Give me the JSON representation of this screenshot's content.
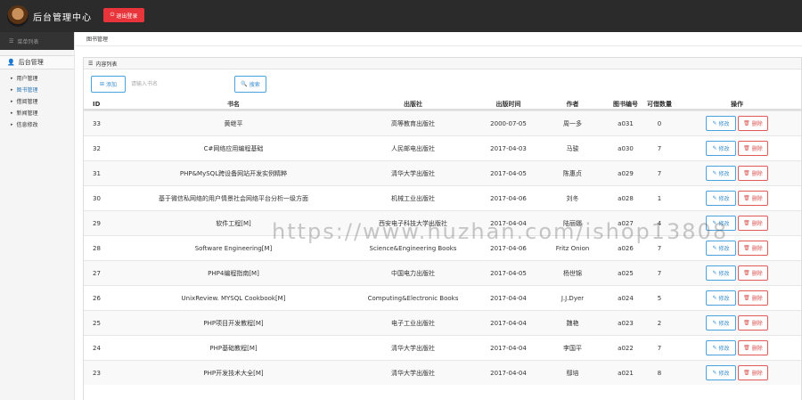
{
  "header": {
    "title": "后台管理中心",
    "logout_label": "退出登录",
    "accent": "#e7353b"
  },
  "sidebar": {
    "top_label": "菜单列表",
    "section_title": "后台管理",
    "items": [
      {
        "label": "用户管理"
      },
      {
        "label": "图书管理"
      },
      {
        "label": "借阅管理"
      },
      {
        "label": "新闻管理"
      },
      {
        "label": "信息修改"
      }
    ]
  },
  "main": {
    "breadcrumb": "图书管理",
    "panel_title": "内容列表",
    "add_label": "添加",
    "search_placeholder": "请输入书名",
    "search_label": "搜索"
  },
  "table": {
    "headers": [
      "ID",
      "书名",
      "出版社",
      "出版时间",
      "作者",
      "图书编号",
      "可借数量",
      "操作"
    ],
    "edit_label": "修改",
    "delete_label": "删除",
    "rows": [
      [
        "33",
        "黄继平",
        "高等教育出版社",
        "2000-07-05",
        "周一多",
        "a031",
        "0"
      ],
      [
        "32",
        "C#网络应用编程基础",
        "人民邮电出版社",
        "2017-04-03",
        "马骏",
        "a030",
        "7"
      ],
      [
        "31",
        "PHP&MySQL跨设备网站开发实例精粹",
        "清华大学出版社",
        "2017-04-05",
        "陈惠贞",
        "a029",
        "7"
      ],
      [
        "30",
        "基于微信私网络的用户情景社会网络平台分析一级方面",
        "机械工业出版社",
        "2017-04-06",
        "刘冬",
        "a028",
        "1"
      ],
      [
        "29",
        "软件工程[M]",
        "西安电子科技大学出版社",
        "2017-04-04",
        "陆丽娜",
        "a027",
        "4"
      ],
      [
        "28",
        "Software Engineering[M]",
        "Science&Engineering Books",
        "2017-04-06",
        "Fritz Onion",
        "a026",
        "7"
      ],
      [
        "27",
        "PHP4编程指南[M]",
        "中国电力出版社",
        "2017-04-05",
        "杨世锦",
        "a025",
        "7"
      ],
      [
        "26",
        "UnixReview. MYSQL Cookbook[M]",
        "Computing&Electronic Books",
        "2017-04-04",
        "J.J.Dyer",
        "a024",
        "5"
      ],
      [
        "25",
        "PHP项目开发教程[M]",
        "电子工业出版社",
        "2017-04-04",
        "魏艳",
        "a023",
        "2"
      ],
      [
        "24",
        "PHP基础教程[M]",
        "清华大学出版社",
        "2017-04-04",
        "李国平",
        "a022",
        "7"
      ],
      [
        "23",
        "PHP开发技术大全[M]",
        "清华大学出版社",
        "2017-04-04",
        "鄢培",
        "a021",
        "8"
      ]
    ]
  },
  "watermark": "https://www.huzhan.com/ishop13808"
}
